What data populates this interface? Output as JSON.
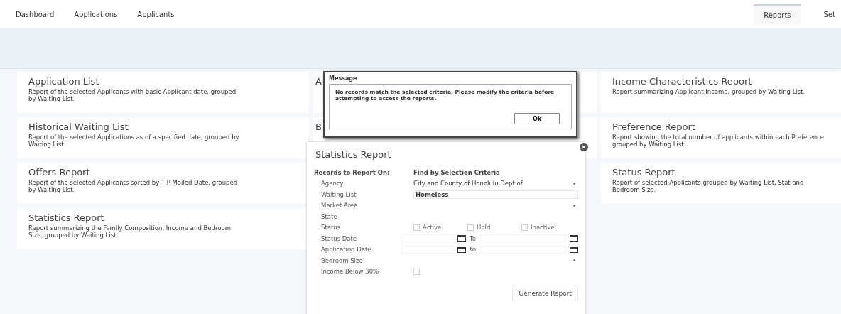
{
  "nav": {
    "links": [
      {
        "label": "Dashboard",
        "selected": false
      },
      {
        "label": "Applications",
        "selected": false
      },
      {
        "label": "Applicants",
        "selected": false
      }
    ],
    "right_tabs": [
      {
        "label": "Reports",
        "selected": true
      },
      {
        "label": "Set",
        "selected": false
      }
    ]
  },
  "report_columns": [
    [
      {
        "title": "Application List",
        "description": "Report of the selected Applicants with basic Applicant date, grouped by Waiting List."
      },
      {
        "title": "Historical Waiting List",
        "description": "Report of the selected Applications as of a specified date, grouped by Waiting List."
      },
      {
        "title": "Offers Report",
        "description": "Report of the selected Applicants sorted by TIP Mailed Date, grouped by Waiting List."
      },
      {
        "title": "Statistics Report",
        "description": "Report summarizing the Family Composition, Income and Bedroom Size, grouped by Waiting List."
      }
    ],
    [
      {
        "title": "A"
      },
      {
        "title": "B"
      }
    ],
    [
      {
        "title": "Income Characteristics Report",
        "description": "Report summarizing Applicant Income, grouped by Waiting List."
      },
      {
        "title": "Preference Report",
        "description": "Report showing the total number of applicants within each Preference grouped by Waiting List"
      },
      {
        "title": "Status Report",
        "description": "Report of selected Applicants grouped by Waiting List, Stat and Bedroom Size."
      }
    ]
  ],
  "panel": {
    "title": "Statistics Report",
    "records_label": "Records to Report On:",
    "records_value": "Find by Selection Criteria",
    "fields": [
      {
        "kind": "select",
        "label": "Agency",
        "value": "City and County of Honolulu Dept of"
      },
      {
        "kind": "input",
        "label": "Waiting List",
        "value": "Homeless"
      },
      {
        "kind": "select",
        "label": "Market Area"
      },
      {
        "kind": "blank",
        "label": "State"
      },
      {
        "kind": "checks",
        "label": "Status",
        "options": [
          {
            "label": "Active",
            "checked": false
          },
          {
            "label": "Hold",
            "checked": false
          },
          {
            "label": "Inactive",
            "checked": false
          }
        ]
      },
      {
        "kind": "daterange",
        "label": "Status Date",
        "to": "To"
      },
      {
        "kind": "daterange",
        "label": "Application Date",
        "to": "to"
      },
      {
        "kind": "select",
        "label": "Bedroom Size"
      },
      {
        "kind": "checkbox",
        "label": "Income Below 30%",
        "checked": false
      }
    ],
    "button": "Generate Report"
  },
  "dialog": {
    "title": "Message",
    "text": "No records match the selected criteria. Please modify the criteria before attempting to access the reports.",
    "button": "Ok"
  }
}
